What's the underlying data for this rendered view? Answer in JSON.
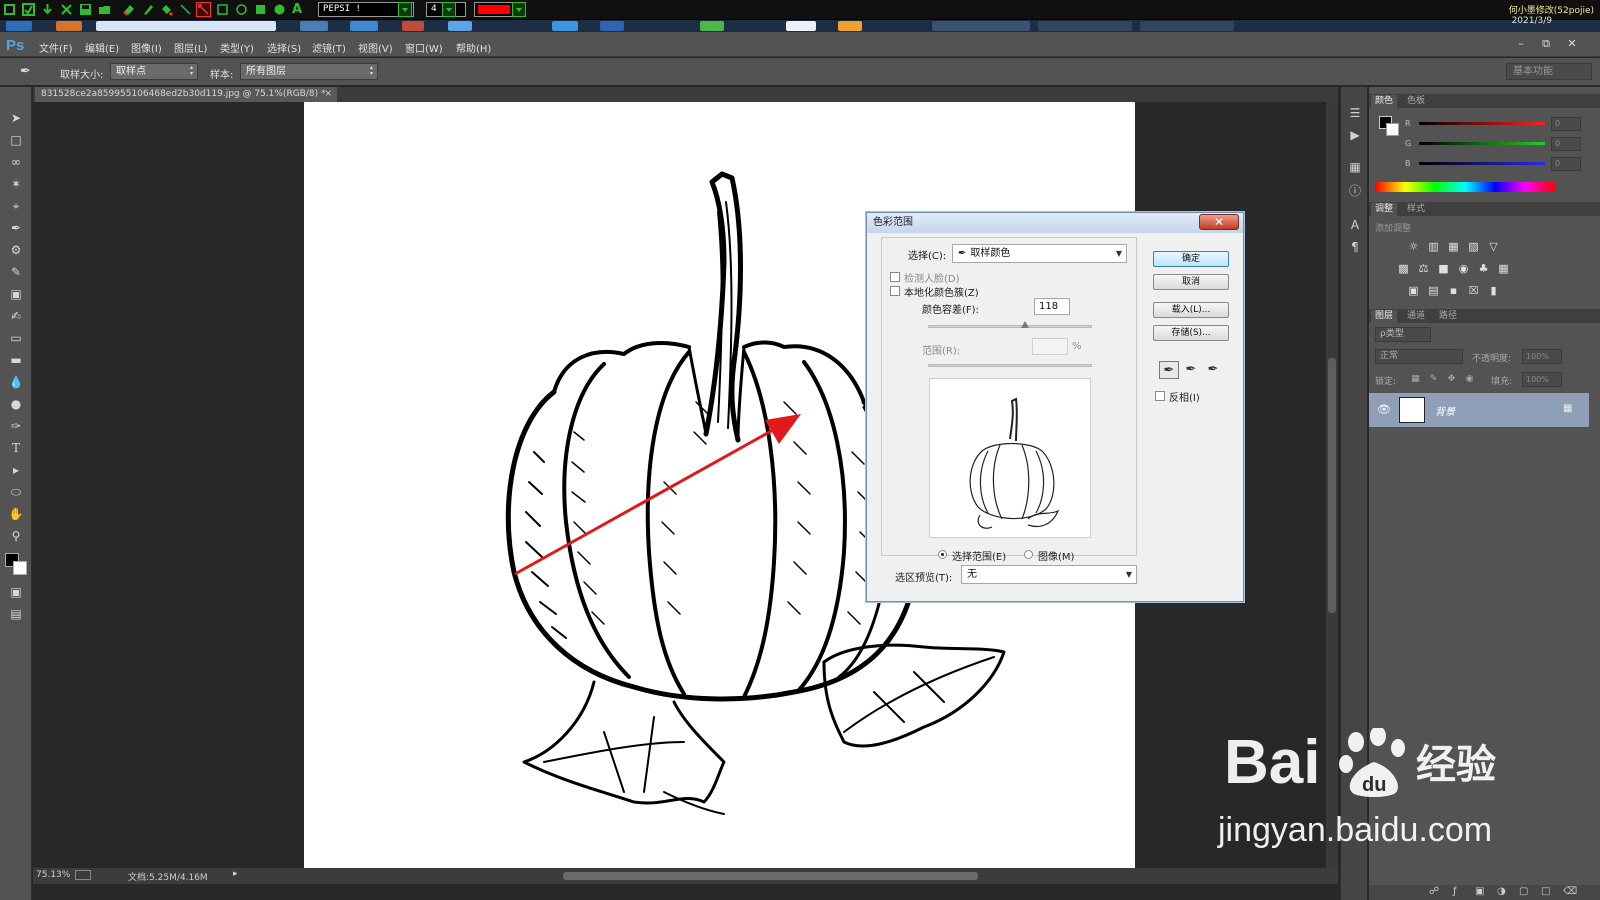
{
  "annotation_toolbar": {
    "font_name": "PEPSI !",
    "font_size": "4",
    "current_color": "#ff0000",
    "top_right_text": "何小墨修改(52pojie)",
    "date": "2021/3/9"
  },
  "menubar": {
    "logo": "Ps",
    "items": [
      "文件(F)",
      "编辑(E)",
      "图像(I)",
      "图层(L)",
      "类型(Y)",
      "选择(S)",
      "滤镜(T)",
      "视图(V)",
      "窗口(W)",
      "帮助(H)"
    ]
  },
  "options_bar": {
    "sample_size_label": "取样大小:",
    "sample_size_value": "取样点",
    "sample_label": "样本:",
    "sample_value": "所有图层",
    "workspace": "基本功能"
  },
  "document": {
    "tab_title": "831528ce2a859955106468ed2b30d119.jpg @ 75.1%(RGB/8) *",
    "zoom": "75.13%",
    "doc_info": "文档:5.25M/4.16M"
  },
  "panels": {
    "color_tabs": [
      "颜色",
      "色板"
    ],
    "rgb": [
      {
        "label": "R",
        "value": "0",
        "color": "#e52121"
      },
      {
        "label": "G",
        "value": "0",
        "color": "#20c020"
      },
      {
        "label": "B",
        "value": "0",
        "color": "#2a2ad8"
      }
    ],
    "adjust_tabs": [
      "调整",
      "样式"
    ],
    "adjust_title": "添加调整",
    "layers_tabs": [
      "图层",
      "通道",
      "路径"
    ],
    "kind_filter": "ρ类型",
    "blend_mode": "正常",
    "opacity_label": "不透明度:",
    "opacity_value": "100%",
    "lock_label": "锁定:",
    "fill_label": "填充:",
    "fill_value": "100%",
    "layer_name": "背景"
  },
  "dialog": {
    "title": "色彩范围",
    "select_label": "选择(C):",
    "select_value": "取样颜色",
    "detect_faces": "检测人脸(D)",
    "localized": "本地化颜色簇(Z)",
    "fuzziness_label": "颜色容差(F):",
    "fuzziness_value": "118",
    "fuzziness_fraction": 0.59,
    "range_label": "范围(R):",
    "range_unit": "%",
    "radio_selection": "选择范围(E)",
    "radio_image": "图像(M)",
    "preview_label": "选区预览(T):",
    "preview_value": "无",
    "buttons": {
      "ok": "确定",
      "cancel": "取消",
      "load": "载入(L)...",
      "save": "存储(S)..."
    },
    "invert": "反相(I)"
  },
  "watermark": {
    "brand": "Bai",
    "brand_cn": "经验",
    "url": "jingyan.baidu.com"
  }
}
